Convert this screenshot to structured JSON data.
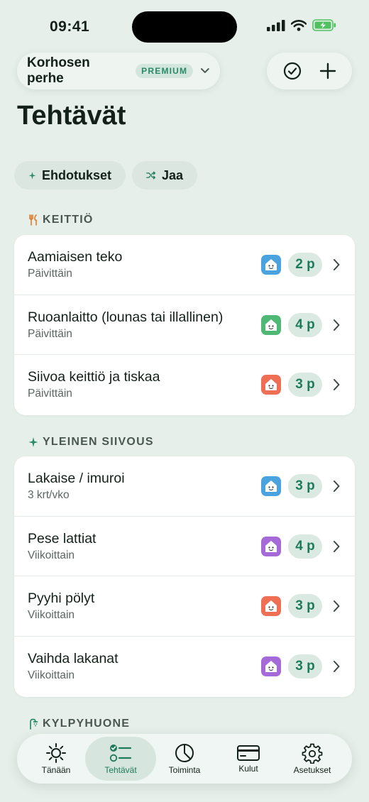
{
  "status": {
    "time": "09:41"
  },
  "header": {
    "family_name": "Korhosen perhe",
    "badge": "PREMIUM"
  },
  "page": {
    "title": "Tehtävät"
  },
  "chips": [
    {
      "label": "Ehdotukset",
      "icon": "sparkle-icon"
    },
    {
      "label": "Jaa",
      "icon": "shuffle-icon"
    }
  ],
  "sections": [
    {
      "title": "KEITTIÖ",
      "icon": "fork-knife-icon",
      "rows": [
        {
          "title": "Aamiaisen teko",
          "frequency": "Päivittäin",
          "points": "2 p",
          "avatar_color": "#4aa3de"
        },
        {
          "title": "Ruoanlaitto (lounas tai illallinen)",
          "frequency": "Päivittäin",
          "points": "4 p",
          "avatar_color": "#4fb874"
        },
        {
          "title": "Siivoa keittiö ja tiskaa",
          "frequency": "Päivittäin",
          "points": "3 p",
          "avatar_color": "#ef6f55"
        }
      ]
    },
    {
      "title": "YLEINEN SIIVOUS",
      "icon": "sparkle-icon",
      "rows": [
        {
          "title": "Lakaise / imuroi",
          "frequency": "3 krt/vko",
          "points": "3 p",
          "avatar_color": "#4aa3de"
        },
        {
          "title": "Pese lattiat",
          "frequency": "Viikoittain",
          "points": "4 p",
          "avatar_color": "#a56ad8"
        },
        {
          "title": "Pyyhi pölyt",
          "frequency": "Viikoittain",
          "points": "3 p",
          "avatar_color": "#ef6f55"
        },
        {
          "title": "Vaihda lakanat",
          "frequency": "Viikoittain",
          "points": "3 p",
          "avatar_color": "#a56ad8"
        }
      ]
    },
    {
      "title": "KYLPYHUONE",
      "icon": "shower-icon"
    }
  ],
  "tabbar": [
    {
      "label": "Tänään",
      "icon": "sun-icon"
    },
    {
      "label": "Tehtävät",
      "icon": "checklist-icon",
      "active": true
    },
    {
      "label": "Toiminta",
      "icon": "pie-chart-icon"
    },
    {
      "label": "Kulut",
      "icon": "card-icon"
    },
    {
      "label": "Asetukset",
      "icon": "gear-icon"
    }
  ],
  "colors": {
    "accent": "#1e7a5c",
    "background": "#e7efea",
    "badge_text": "#2a8a68"
  }
}
